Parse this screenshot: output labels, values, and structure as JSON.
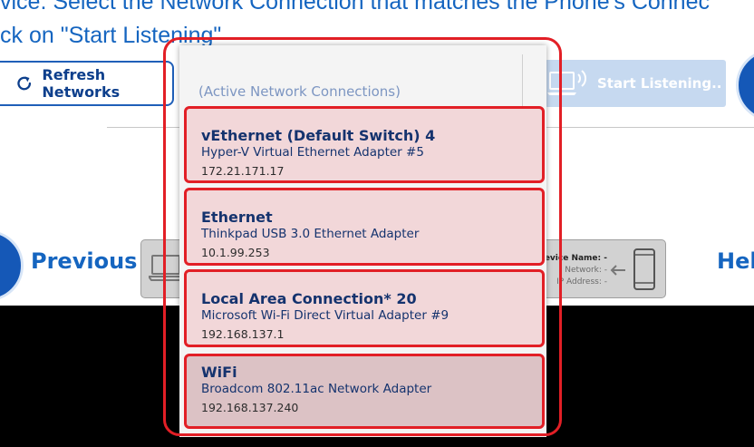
{
  "instruction": {
    "line1": "vice. Select the Network Connection that matches the Phone's Connec",
    "line2": "ck on \"Start Listening\""
  },
  "toolbar": {
    "refresh_label": "Refresh Networks",
    "start_label": "Start Listening.."
  },
  "navigation": {
    "previous_label": "Previous",
    "help_label": "Hel"
  },
  "device": {
    "name_label": "Device Name: -",
    "network_label": "Network: -",
    "ip_label": "IP Address: -"
  },
  "dropdown": {
    "header": "(Active Network Connections)",
    "items": [
      {
        "name": "vEthernet (Default Switch) 4",
        "adapter": "Hyper-V Virtual Ethernet Adapter #5",
        "ip": "172.21.171.17"
      },
      {
        "name": "Ethernet",
        "adapter": "Thinkpad USB 3.0 Ethernet Adapter",
        "ip": "10.1.99.253"
      },
      {
        "name": "Local Area Connection* 20",
        "adapter": "Microsoft Wi-Fi Direct Virtual Adapter #9",
        "ip": "192.168.137.1"
      },
      {
        "name": "WiFi",
        "adapter": "Broadcom 802.11ac Network Adapter",
        "ip": "192.168.137.240"
      }
    ]
  },
  "colors": {
    "accent_blue": "#1565c0",
    "highlight_red": "#e21f26",
    "item_bg": "#f2d7d9"
  },
  "icons": {
    "refresh": "refresh-icon",
    "laptop": "laptop-icon",
    "phone": "phone-icon",
    "arrow": "arrow-left-icon",
    "wifi": "wifi-icon"
  }
}
